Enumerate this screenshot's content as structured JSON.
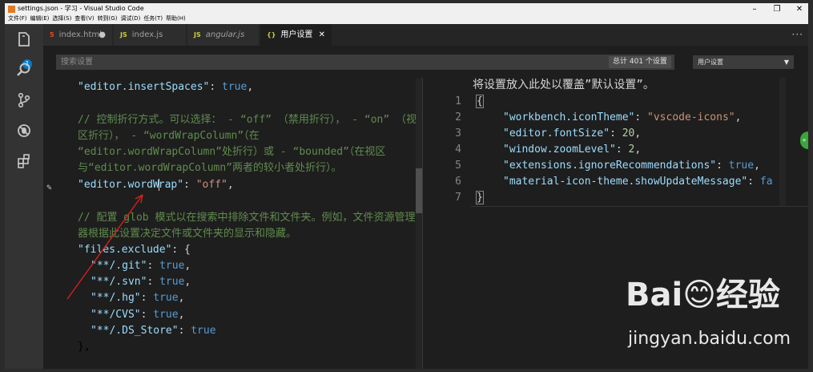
{
  "window": {
    "title": "settings.json - 学习 - Visual Studio Code",
    "menu": [
      "文件(F)",
      "编辑(E)",
      "选择(S)",
      "查看(V)",
      "转到(G)",
      "调试(D)",
      "任务(T)",
      "帮助(H)"
    ],
    "controls": [
      "–",
      "❐",
      "✕"
    ]
  },
  "activity_bar": {
    "badge_count": "1",
    "icons": [
      "files-icon",
      "search-icon",
      "source-control-icon",
      "debug-icon",
      "extensions-icon"
    ]
  },
  "tabs": [
    {
      "label": "index.html",
      "icon": "5",
      "icon_color": "#e44d26",
      "modified": "●"
    },
    {
      "label": "index.js",
      "icon": "JS",
      "icon_color": "#cbcb41",
      "modified": ""
    },
    {
      "label": "angular.js",
      "icon": "JS",
      "icon_color": "#cbcb41",
      "modified": ""
    },
    {
      "label": "用户设置",
      "icon": "{}",
      "icon_color": "#cbcb41",
      "close": "✕"
    }
  ],
  "tabbar_more": "···",
  "search": {
    "placeholder": "搜索设置",
    "count_label": "总计 401 个设置",
    "scope_selected": "用户设置"
  },
  "default_settings": {
    "insert_spaces_key": "\"editor.insertSpaces\"",
    "insert_spaces_value": "true",
    "wordwrap_comment": "// 控制折行方式。可以选择：  - “off” （禁用折行），  - “on” （视区折行），  - “wordWrapColumn”（在 “editor.wordWrapColumn”处折行）或  - “bounded”（在视区与“editor.wordWrapColumn”两者的较小者处折行）。",
    "wordwrap_key_a": "\"editor.wordW",
    "wordwrap_key_b": "rap\"",
    "wordwrap_value": "\"off\"",
    "exclude_comment": "// 配置 glob 模式以在搜索中排除文件和文件夹。例如，文件资源管理器根据此设置决定文件或文件夹的显示和隐藏。",
    "exclude_key": "\"files.exclude\"",
    "exclude_items": [
      {
        "key": "\"**/.git\"",
        "value": "true"
      },
      {
        "key": "\"**/.svn\"",
        "value": "true"
      },
      {
        "key": "\"**/.hg\"",
        "value": "true"
      },
      {
        "key": "\"**/CVS\"",
        "value": "true"
      },
      {
        "key": "\"**/.DS_Store\"",
        "value": "true"
      }
    ],
    "closing": "},"
  },
  "user_settings": {
    "title": "将设置放入此处以覆盖”默认设置”。",
    "line_numbers": [
      "1",
      "2",
      "3",
      "4",
      "5",
      "6",
      "7"
    ],
    "open_brace": "{",
    "close_brace": "}",
    "entries": [
      {
        "key": "\"workbench.iconTheme\"",
        "value": "\"vscode-icons\"",
        "type": "string",
        "trail": ","
      },
      {
        "key": "\"editor.fontSize\"",
        "value": "20",
        "type": "number",
        "trail": ","
      },
      {
        "key": "\"window.zoomLevel\"",
        "value": "2",
        "type": "number",
        "trail": ","
      },
      {
        "key": "\"extensions.ignoreRecommendations\"",
        "value": "true",
        "type": "bool",
        "trail": ","
      },
      {
        "key": "\"material-icon-theme.showUpdateMessage\"",
        "value": "fa",
        "type": "bool",
        "trail": ""
      }
    ]
  },
  "watermark": {
    "logo": "Bai😊经验",
    "url": "jingyan.baidu.com"
  }
}
